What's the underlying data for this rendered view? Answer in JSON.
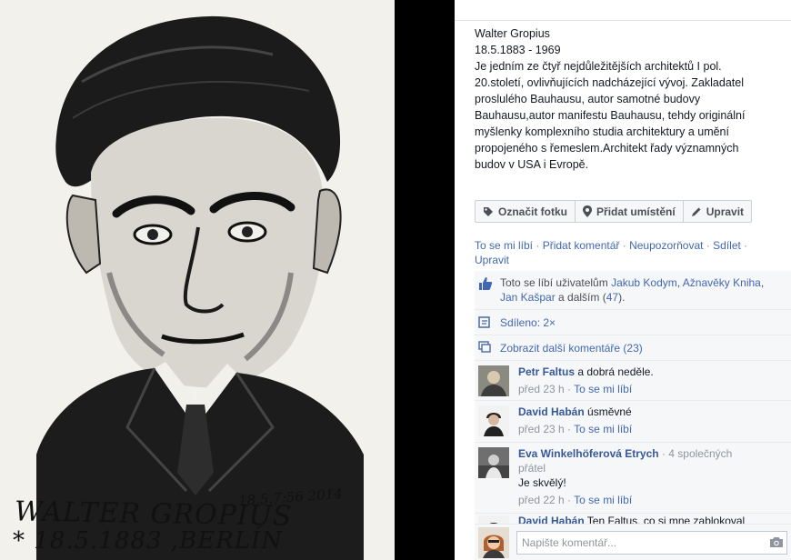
{
  "photo": {
    "caption_name": "WALTER GROPIUS",
    "caption_birth": "* 18.5.1883 ,BERLÍN",
    "caption_date": "18.5.7:56 2014"
  },
  "description": {
    "lines": [
      "Walter Gropius",
      "18.5.1883 - 1969",
      "Je jedním ze čtyř nejdůležitějších architektů I pol.",
      "20.století, ovlivňujících nadcházející vývoj. Zakladatel",
      "proslulého Bauhausu, autor samotné budovy",
      "Bauhausu,autor manifestu Bauhausu, tehdy originální",
      "myšlenky komplexního studia architektury a umění",
      "propojeného s řemeslem.Architekt řady významných",
      "budov v USA i Evropě."
    ]
  },
  "actions": {
    "tag_label": "Označit fotku",
    "location_label": "Přidat umístění",
    "edit_label": "Upravit"
  },
  "links": {
    "like": "To se mi líbí",
    "comment": "Přidat komentář",
    "unfollow": "Neupozorňovat",
    "share": "Sdílet",
    "edit": "Upravit",
    "sep": " · "
  },
  "likes": {
    "prefix": "Toto se líbí uživatelům ",
    "user1": "Jakub Kodym",
    "sep1": ", ",
    "user2": "Ažnavěky Kniha",
    "sep2": ",",
    "user3": "Jan Kašpar",
    "and_others": " a dalším (",
    "count": "47",
    "suffix": ")."
  },
  "shared": {
    "label": "Sdíleno: 2×"
  },
  "more_comments": {
    "label": "Zobrazit další komentáře (23)"
  },
  "comments": [
    {
      "author": "Petr Faltus",
      "text": " a dobrá neděle.",
      "time": "před 23 h",
      "like": "To se mi líbí"
    },
    {
      "author": "David Habán",
      "text": " úsměvné",
      "time": "před 23 h",
      "like": "To se mi líbí"
    },
    {
      "author": "Eva Winkelhöferová Etrych",
      "mutual": " · 4 společných",
      "mutual2": "přátel",
      "text": "Je skvělý!",
      "time": "před 22 h",
      "like": "To se mi líbí"
    },
    {
      "author": "David Habán",
      "text": " Ten Faltus, co si mne zablokoval"
    }
  ],
  "composer": {
    "placeholder": "Napište komentář..."
  },
  "meta_sep": " · ",
  "icons": [
    "tag-icon",
    "location-pin-icon",
    "pencil-icon",
    "thumbs-up-icon",
    "share-icon",
    "comments-icon",
    "camera-icon"
  ],
  "colors": {
    "link": "#4267b2",
    "author": "#365899",
    "muted": "#90949c",
    "panel_bg": "#f6f7f9"
  }
}
